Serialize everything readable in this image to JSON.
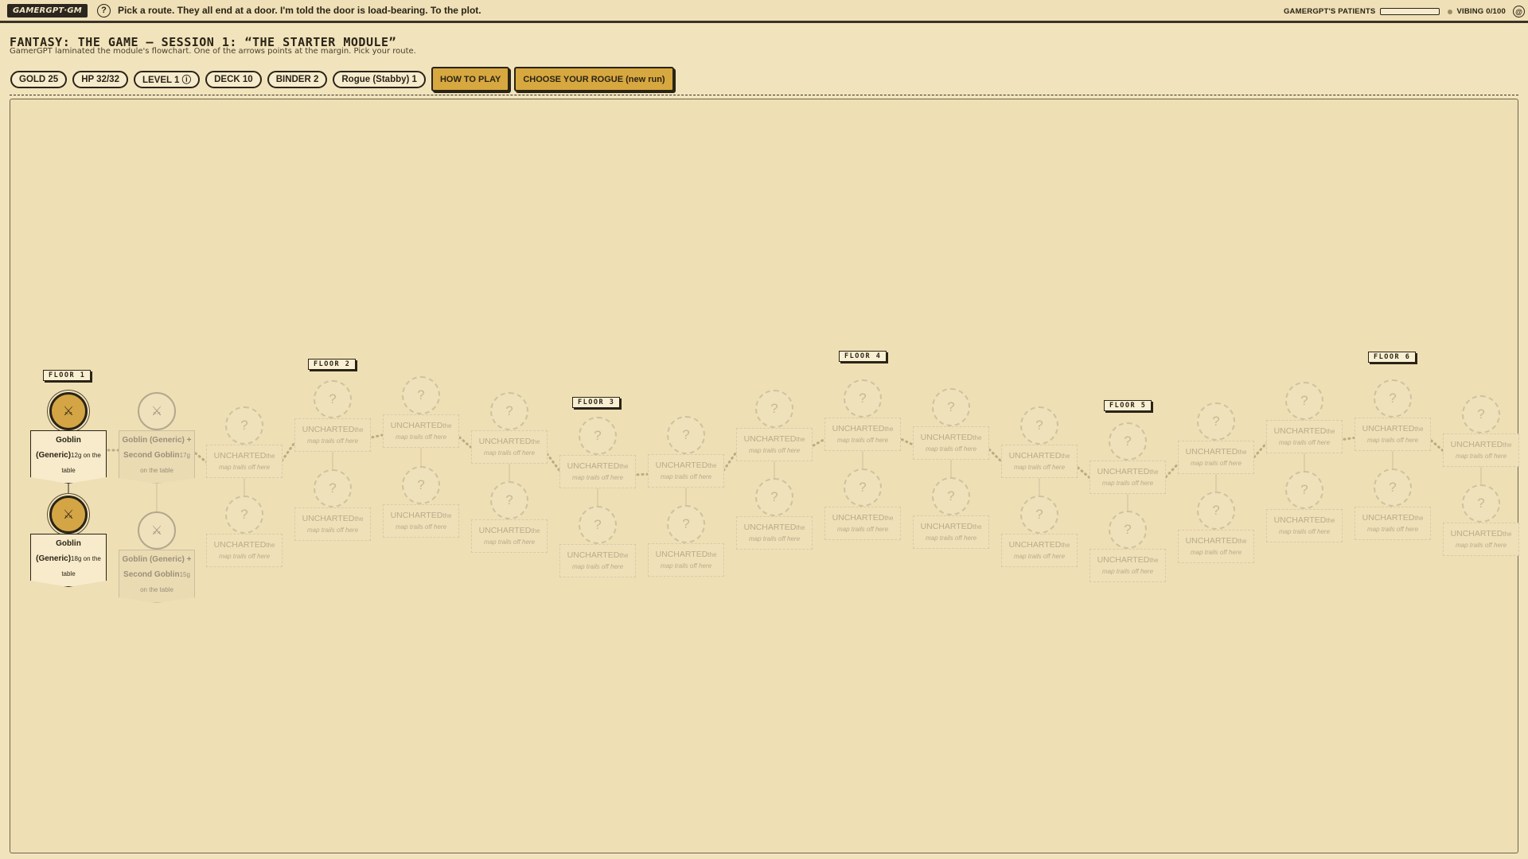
{
  "topbar": {
    "brand": "GAMERGPT·GM",
    "help_icon": "?",
    "tagline": "Pick a route. They all end at a door. I'm told the door is load-bearing. To the plot.",
    "patients_label": "GAMERGPT'S PATIENTS",
    "patience_fill": 0,
    "vibing": "VIBING 0/100",
    "chip": "@"
  },
  "header": {
    "title": "FANTASY: THE GAME — SESSION 1: “THE STARTER MODULE”",
    "subtitle": "GamerGPT laminated the module's flowchart. One of the arrows points at the margin. Pick your route."
  },
  "stats": {
    "gold": "GOLD 25",
    "hp": "HP 32/32",
    "level": "LEVEL 1 ⓘ",
    "deck": "DECK 10",
    "binder": "BINDER 2",
    "rogue": "Rogue (Stabby) 1",
    "how_to_play": "HOW TO PLAY",
    "choose": "CHOOSE YOUR ROGUE (new run)"
  },
  "floors": [
    "FLOOR 1",
    "FLOOR 2",
    "FLOOR 3",
    "FLOOR 4",
    "FLOOR 5",
    "FLOOR 6"
  ],
  "encounter_icon": "⚔",
  "unknown_icon": "?",
  "unknown_label": {
    "title": "UNCHARTED",
    "tail": "the",
    "sub": "map trails off here"
  },
  "nodes": [
    {
      "state": "active",
      "name": "Goblin (Generic)",
      "suffix": "12g on the table"
    },
    {
      "state": "active",
      "name": "Goblin (Generic)",
      "suffix": "18g on the table"
    },
    {
      "state": "next",
      "name": "Goblin (Generic) + Second Goblin",
      "suffix": "17g on the table"
    },
    {
      "state": "next",
      "name": "Goblin (Generic) + Second Goblin",
      "suffix": "15g on the table"
    }
  ],
  "colors": {
    "parchment": "#f1e3bb",
    "ink": "#2a2416",
    "gold": "#d4a545",
    "button": "#d7a83f"
  }
}
